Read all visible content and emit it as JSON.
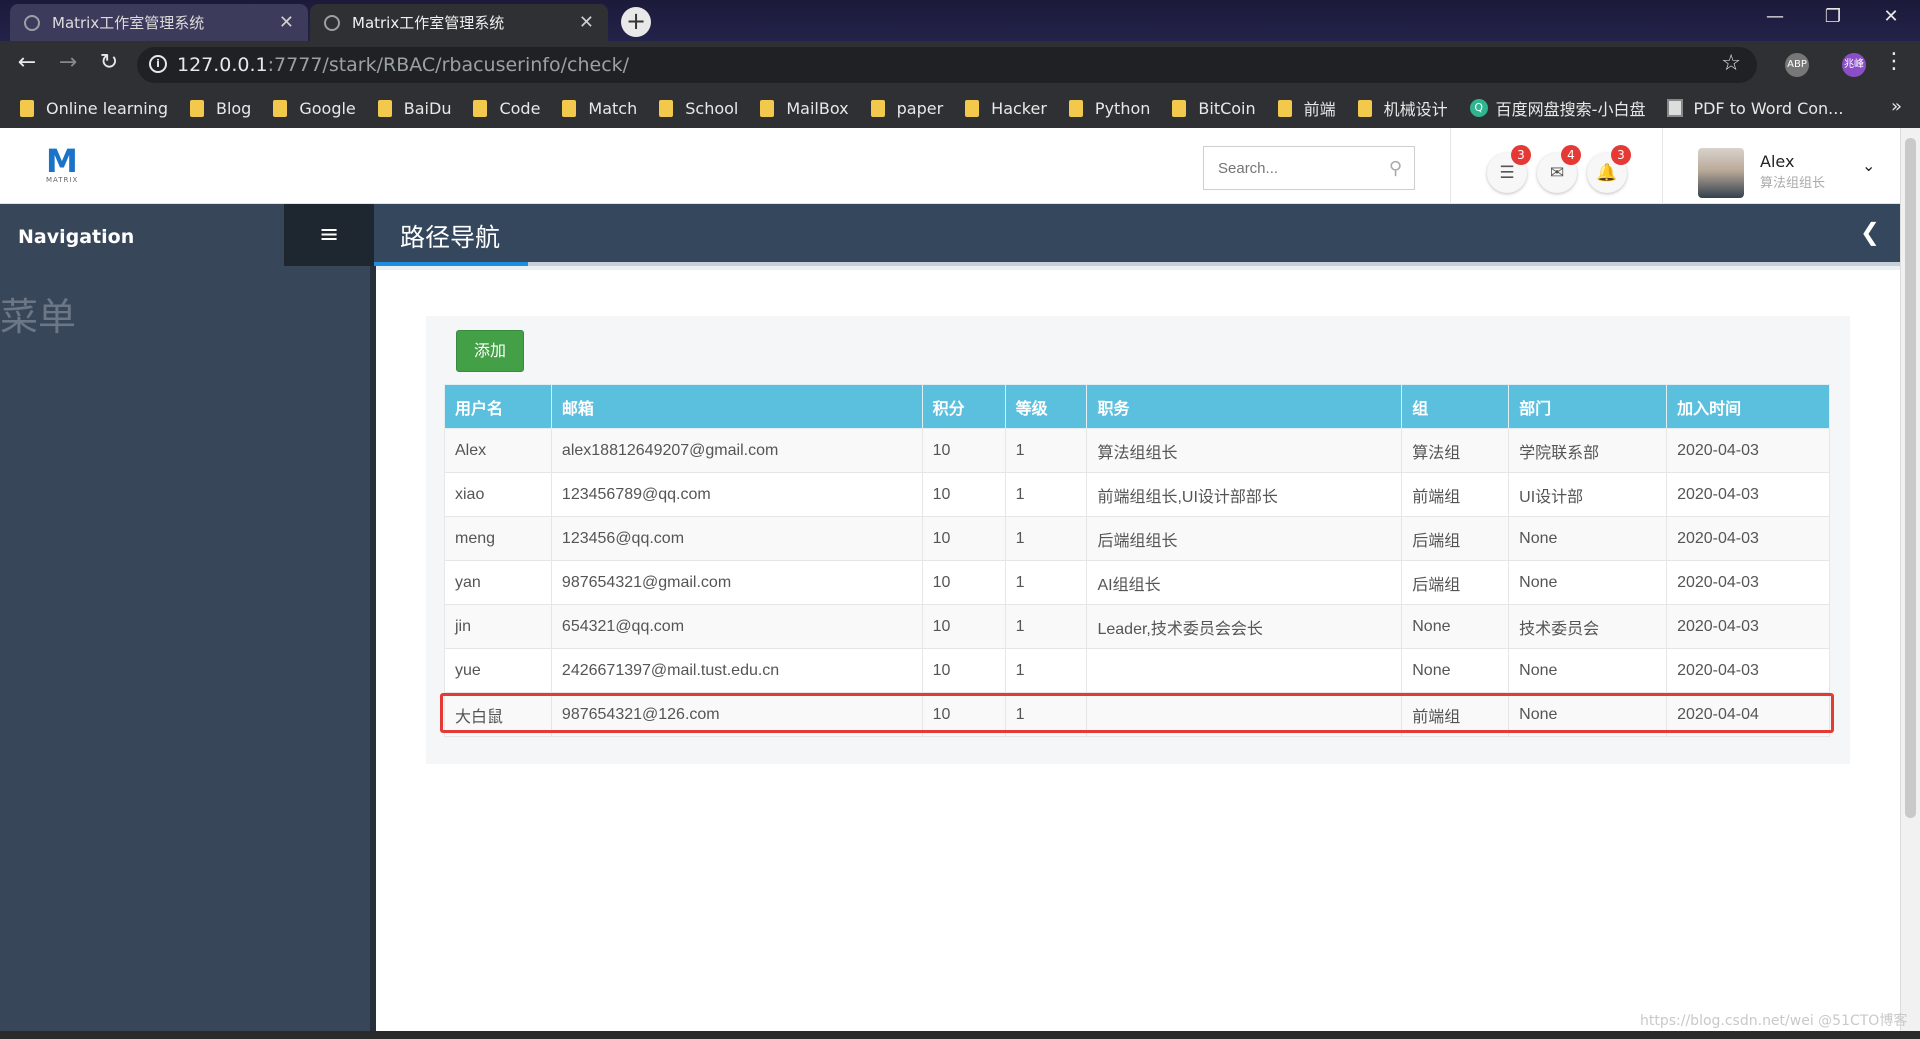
{
  "browser": {
    "tabs": [
      {
        "label": "Matrix工作室管理系统",
        "close": "✕"
      },
      {
        "label": "Matrix工作室管理系统",
        "close": "✕"
      }
    ],
    "url_host": "127.0.0.1",
    "url_path": ":7777/stark/RBAC/rbacuserinfo/check/",
    "profile_initials": "兆峰",
    "ext_abp": "ABP",
    "bookmarks": [
      "Online learning",
      "Blog",
      "Google",
      "BaiDu",
      "Code",
      "Match",
      "School",
      "MailBox",
      "paper",
      "Hacker",
      "Python",
      "BitCoin",
      "前端",
      "机械设计"
    ],
    "bookmark_search": "百度网盘搜索-小白盘",
    "bookmark_pdf": "PDF to Word Con..."
  },
  "header": {
    "logo": "M",
    "logo_sub": "MATRIX",
    "search_placeholder": "Search...",
    "badges": {
      "tasks": "3",
      "mail": "4",
      "alerts": "3"
    },
    "user_name": "Alex",
    "user_role": "算法组组长"
  },
  "sidebar": {
    "title": "Navigation",
    "menu_label": "菜单"
  },
  "breadcrumb": {
    "title": "路径导航"
  },
  "content": {
    "add_label": "添加",
    "columns": [
      "用户名",
      "邮箱",
      "积分",
      "等级",
      "职务",
      "组",
      "部门",
      "加入时间"
    ],
    "rows": [
      [
        "Alex",
        "alex18812649207@gmail.com",
        "10",
        "1",
        "算法组组长",
        "算法组",
        "学院联系部",
        "2020-04-03"
      ],
      [
        "xiao",
        "123456789@qq.com",
        "10",
        "1",
        "前端组组长,UI设计部部长",
        "前端组",
        "UI设计部",
        "2020-04-03"
      ],
      [
        "meng",
        "123456@qq.com",
        "10",
        "1",
        "后端组组长",
        "后端组",
        "None",
        "2020-04-03"
      ],
      [
        "yan",
        "987654321@gmail.com",
        "10",
        "1",
        "AI组组长",
        "后端组",
        "None",
        "2020-04-03"
      ],
      [
        "jin",
        "654321@qq.com",
        "10",
        "1",
        "Leader,技术委员会会长",
        "None",
        "技术委员会",
        "2020-04-03"
      ],
      [
        "yue",
        "2426671397@mail.tust.edu.cn",
        "10",
        "1",
        "",
        "None",
        "None",
        "2020-04-03"
      ],
      [
        "大白鼠",
        "987654321@126.com",
        "10",
        "1",
        "",
        "前端组",
        "None",
        "2020-04-04"
      ]
    ]
  },
  "watermark": "https://blog.csdn.net/wei @51CTO博客",
  "colors": {
    "header_bg": "#5bc0de",
    "add_button": "#43a047",
    "sidebar": "#374659",
    "highlight": "#e53935"
  }
}
